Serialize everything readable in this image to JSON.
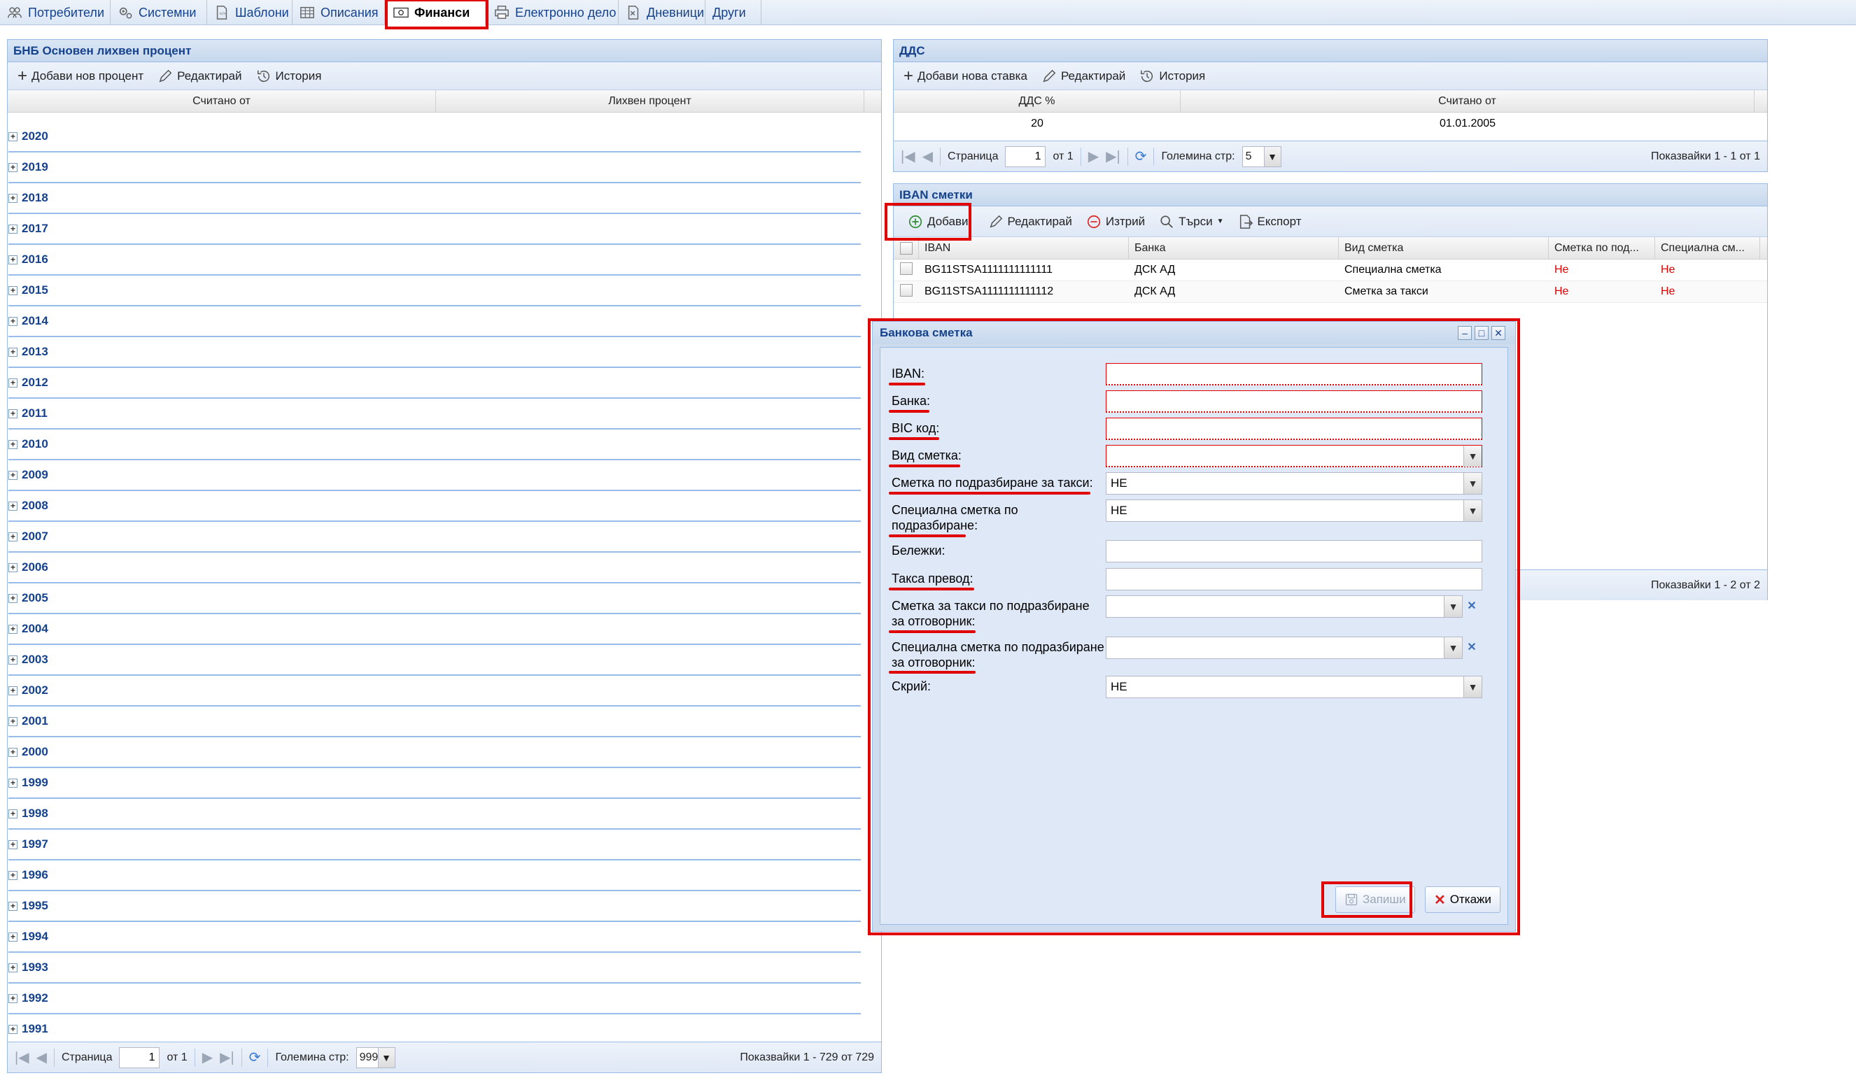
{
  "topnav": {
    "tabs": [
      {
        "label": "Потребители",
        "icon": "users-icon"
      },
      {
        "label": "Системни",
        "icon": "gears-icon"
      },
      {
        "label": "Шаблони",
        "icon": "template-icon"
      },
      {
        "label": "Описания",
        "icon": "table-icon"
      },
      {
        "label": "Финанси",
        "icon": "money-icon",
        "active": true
      },
      {
        "label": "Електронно дело",
        "icon": "printer-icon"
      },
      {
        "label": "Дневници",
        "icon": "log-icon"
      },
      {
        "label": "Други",
        "icon": ""
      }
    ]
  },
  "left_panel": {
    "title": "БНБ Основен лихвен процент",
    "toolbar": {
      "add": "Добави нов процент",
      "edit": "Редактирай",
      "history": "История"
    },
    "columns": [
      "Считано от",
      "Лихвен процент"
    ],
    "groups": [
      "2020",
      "2019",
      "2018",
      "2017",
      "2016",
      "2015",
      "2014",
      "2013",
      "2012",
      "2011",
      "2010",
      "2009",
      "2008",
      "2007",
      "2006",
      "2005",
      "2004",
      "2003",
      "2002",
      "2001",
      "2000",
      "1999",
      "1998",
      "1997",
      "1996",
      "1995",
      "1994",
      "1993",
      "1992",
      "1991"
    ],
    "pager": {
      "page_label": "Страница",
      "page": "1",
      "of": "от 1",
      "size_label": "Големина стр:",
      "size": "999",
      "summary": "Показвайки 1 - 729 от 729"
    }
  },
  "vat_panel": {
    "title": "ДДС",
    "toolbar": {
      "add": "Добави нова ставка",
      "edit": "Редактирай",
      "history": "История"
    },
    "columns": [
      "ДДС %",
      "Считано от"
    ],
    "rows": [
      [
        "20",
        "01.01.2005"
      ]
    ],
    "pager": {
      "page_label": "Страница",
      "page": "1",
      "of": "от 1",
      "size_label": "Големина стр:",
      "size": "5",
      "summary": "Показвайки 1 - 1 от 1"
    }
  },
  "iban_panel": {
    "title": "IBAN сметки",
    "toolbar": {
      "add": "Добави",
      "edit": "Редактирай",
      "delete": "Изтрий",
      "search": "Търси",
      "export": "Експорт"
    },
    "columns": [
      "IBAN",
      "Банка",
      "Вид сметка",
      "Сметка по под...",
      "Специална см..."
    ],
    "rows": [
      {
        "iban": "BG11STSA1111111111111",
        "bank": "ДСК АД",
        "type": "Специална сметка",
        "default_fee": "Не",
        "special": "Не"
      },
      {
        "iban": "BG11STSA1111111111112",
        "bank": "ДСК АД",
        "type": "Сметка за такси",
        "default_fee": "Не",
        "special": "Не"
      }
    ],
    "summary": "Показвайки 1 - 2 от 2"
  },
  "dialog": {
    "title": "Банкова сметка",
    "fields": {
      "iban": {
        "label": "IBAN:",
        "value": ""
      },
      "bank": {
        "label": "Банка:",
        "value": ""
      },
      "bic": {
        "label": "BIC код:",
        "value": ""
      },
      "account_type": {
        "label": "Вид сметка:",
        "value": ""
      },
      "default_fee_account": {
        "label": "Сметка по подразбиране за такси:",
        "value": "НЕ"
      },
      "default_special_account": {
        "label": "Специална сметка по подразбиране:",
        "value": "НЕ"
      },
      "notes": {
        "label": "Бележки:",
        "value": ""
      },
      "transfer_fee": {
        "label": "Такса превод:",
        "value": ""
      },
      "default_fee_account_defendant": {
        "label": "Сметка за такси по подразбиране за отговорник:",
        "value": ""
      },
      "default_special_account_defendant": {
        "label": "Специална сметка по подразбиране за отговорник:",
        "value": ""
      },
      "hide": {
        "label": "Скрий:",
        "value": "НЕ"
      }
    },
    "buttons": {
      "save": "Запиши",
      "cancel": "Откажи"
    }
  },
  "colors": {
    "highlight": "#e00000",
    "header_text": "#15428b",
    "panel_border": "#99bbe8",
    "no_value": "#e00000"
  }
}
